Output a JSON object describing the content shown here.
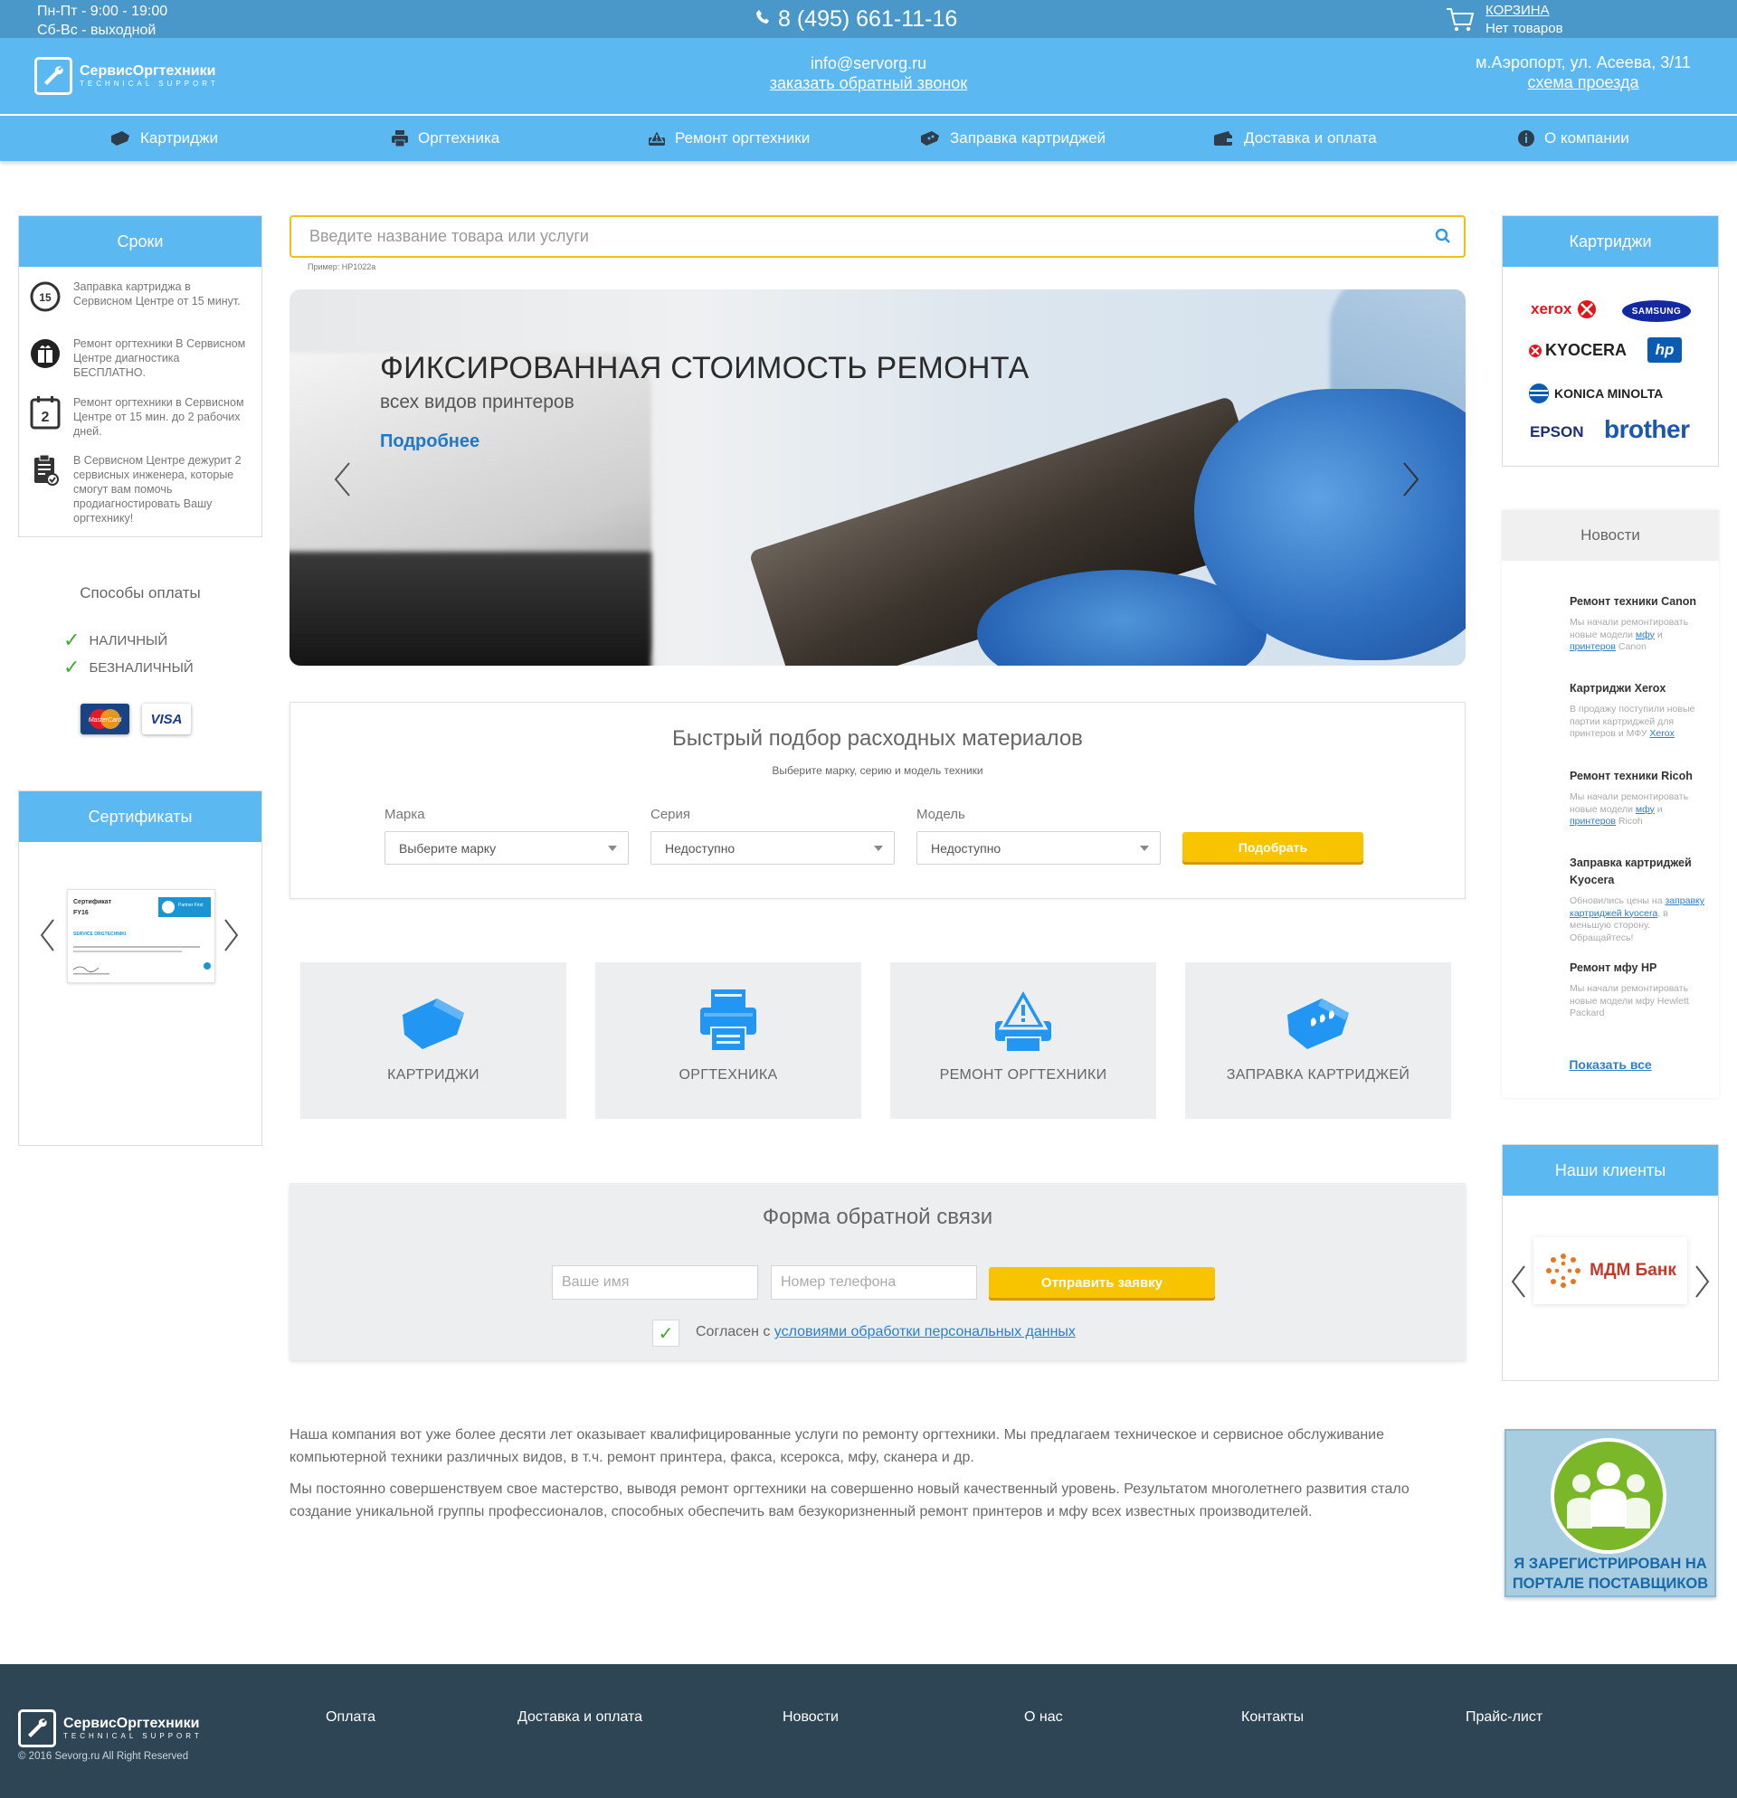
{
  "topbar": {
    "hours_weekdays": "Пн-Пт - 9:00 - 19:00",
    "hours_weekend": "Сб-Вс - выходной",
    "phone": "8 (495) 661-11-16",
    "cart_title": "КОРЗИНА",
    "cart_status": "Нет товаров"
  },
  "header": {
    "logo_name": "СервисОргтехники",
    "logo_tagline": "TECHNICAL SUPPORT",
    "email": "info@servorg.ru",
    "callback": "заказать обратный звонок",
    "address": "м.Аэропорт, ул. Асеева, 3/11",
    "map_link": "схема проезда"
  },
  "nav": {
    "items": [
      {
        "label": "Картриджи",
        "icon": "cartridge-icon"
      },
      {
        "label": "Оргтехника",
        "icon": "printer-icon"
      },
      {
        "label": "Ремонт оргтехники",
        "icon": "repair-icon"
      },
      {
        "label": "Заправка картриджей",
        "icon": "refill-icon"
      },
      {
        "label": "Доставка и оплата",
        "icon": "wallet-icon"
      },
      {
        "label": "О компании",
        "icon": "info-icon"
      }
    ]
  },
  "sroki": {
    "title": "Сроки",
    "items": [
      {
        "text": "Заправка картриджа в Сервисном Центре от 15 минут.",
        "icon": "timer-15-icon"
      },
      {
        "text": "Ремонт оргтехники В Сервисном Центре диагностика БЕСПЛАТНО.",
        "icon": "gift-icon"
      },
      {
        "text": "Ремонт оргтехники в Сервисном Центре от 15 мин. до 2 рабочих дней.",
        "icon": "calendar-2-icon"
      },
      {
        "text": "В Сервисном Центре дежурит 2 сервисных инженера, которые смогут вам помочь продиагностировать Вашу оргтехнику!",
        "icon": "checklist-icon"
      }
    ]
  },
  "payment": {
    "title": "Способы оплаты",
    "methods": [
      "НАЛИЧНЫЙ",
      "БЕЗНАЛИЧНЫЙ"
    ],
    "card_mastercard": "MasterCard",
    "card_visa": "VISA"
  },
  "certificates": {
    "title": "Сертификаты",
    "cert_heading": "Сертификат",
    "cert_code": "FY16",
    "cert_company": "SERVICE ORGTECHNIKI",
    "cert_partner": "Partner First"
  },
  "search": {
    "placeholder": "Введите название товара или услуги",
    "hint": "Пример: HP1022a"
  },
  "banner": {
    "title": "ФИКСИРОВАННАЯ СТОИМОСТЬ РЕМОНТА",
    "subtitle": "всех видов принтеров",
    "more": "Подробнее"
  },
  "picker": {
    "title": "Быстрый подбор расходных материалов",
    "subtitle": "Выберите марку, серию и модель техники",
    "brand_label": "Марка",
    "brand_value": "Выберите марку",
    "series_label": "Серия",
    "series_value": "Недоступно",
    "model_label": "Модель",
    "model_value": "Недоступно",
    "button": "Подобрать"
  },
  "tiles": [
    {
      "label": "КАРТРИДЖИ",
      "icon": "cartridge-icon"
    },
    {
      "label": "ОРГТЕХНИКА",
      "icon": "printer-icon"
    },
    {
      "label": "РЕМОНТ ОРГТЕХНИКИ",
      "icon": "repair-icon"
    },
    {
      "label": "ЗАПРАВКА КАРТРИДЖЕЙ",
      "icon": "refill-icon"
    }
  ],
  "feedback": {
    "title": "Форма обратной связи",
    "name_placeholder": "Ваше имя",
    "phone_placeholder": "Номер телефона",
    "button": "Отправить заявку",
    "consent_prefix": "Согласен с ",
    "consent_link": "условиями обработки персональных данных"
  },
  "about": {
    "p1": "Наша компания вот уже более десяти лет оказывает квалифицированные услуги по ремонту оргтехники. Мы предлагаем техническое и сервисное обслуживание компьютерной техники различных видов, в т.ч. ремонт принтера, факса, ксерокса, мфу, сканера и др.",
    "p2": "Мы постоянно совершенствуем свое мастерство, выводя ремонт оргтехники на совершенно новый качественный уровень. Результатом многолетнего развития стало создание уникальной группы профессионалов, способных обеспечить вам безукоризненный ремонт принтеров и мфу всех известных производителей."
  },
  "brands": {
    "title": "Картриджи",
    "items": [
      "xerox",
      "SAMSUNG",
      "KYOCERA",
      "hp",
      "KONICA MINOLTA",
      "EPSON",
      "brother"
    ]
  },
  "news": {
    "title": "Новости",
    "items": [
      {
        "title": "Ремонт техники Canon",
        "t1": "Мы начали ремонтировать новые модели ",
        "l1": "мфу",
        "t2": " и ",
        "l2": "принтеров",
        "t3": " Canon"
      },
      {
        "title": "Картриджи Xerox",
        "t1": "В продажу поступили новые партии картриджей для принтеров и МФУ ",
        "l1": "Xerox",
        "t2": "",
        "l2": "",
        "t3": ""
      },
      {
        "title": "Ремонт техники Ricoh",
        "t1": "Мы начали ремонтировать новые модели ",
        "l1": "мфу",
        "t2": " и ",
        "l2": "принтеров",
        "t3": " Ricoh"
      },
      {
        "title": "Заправка картриджей Kyocera",
        "t1": "Обновились цены на ",
        "l1": "заправку картриджей kyocera",
        "t2": ", в меньшую сторону. Обращайтесь!",
        "l2": "",
        "t3": ""
      },
      {
        "title": "Ремонт мфу HP",
        "t1": "Мы начали ремонтировать новые модели мфу Hewlett Packard",
        "l1": "",
        "t2": "",
        "l2": "",
        "t3": ""
      }
    ],
    "show_all": "Показать все"
  },
  "clients": {
    "title": "Наши клиенты",
    "client_name": "МДМ Банк"
  },
  "portal": {
    "text": "Я ЗАРЕГИСТРИРОВАН НА ПОРТАЛЕ ПОСТАВЩИКОВ"
  },
  "footer": {
    "logo_name": "СервисОргтехники",
    "logo_tagline": "TECHNICAL SUPPORT",
    "copyright": "© 2016 Sevorg.ru All Right Reserved",
    "links": [
      "Оплата",
      "Доставка и оплата",
      "Новости",
      "О нас",
      "Контакты",
      "Прайс-лист"
    ]
  },
  "colors": {
    "topbar": "#4a98c9",
    "header": "#5cb8f0",
    "accent_yellow": "#f8c400",
    "tile_icon_blue": "#2196f3",
    "footer": "#2e4555"
  }
}
